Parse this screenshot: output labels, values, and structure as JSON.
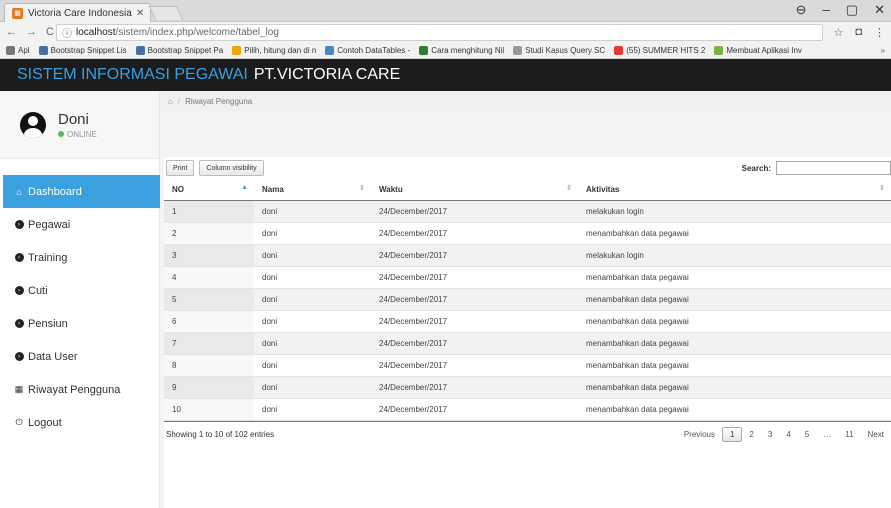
{
  "browser": {
    "tab_title": "Victoria Care Indonesia",
    "url_host": "localhost",
    "url_path": "/sistem/index.php/welcome/tabel_log",
    "bookmarks": [
      {
        "label": "Apl",
        "color": "#777"
      },
      {
        "label": "Bootstrap Snippet Lis",
        "color": "#4a6fa5"
      },
      {
        "label": "Bootstrap Snippet Pa",
        "color": "#4a6fa5"
      },
      {
        "label": "Pilih, hitung dan di n",
        "color": "#f0a500"
      },
      {
        "label": "Contoh DataTables -",
        "color": "#4a86c5"
      },
      {
        "label": "Cara menghitung Nil",
        "color": "#2e7d32"
      },
      {
        "label": "Studi Kasus Query SC",
        "color": "#999"
      },
      {
        "label": "(55) SUMMER HITS 2",
        "color": "#e53935"
      },
      {
        "label": "Membuat Aplikasi Inv",
        "color": "#7cb342"
      }
    ],
    "more": "»"
  },
  "app": {
    "title_blue": "SISTEM INFORMASI PEGAWAI",
    "title_white": "PT.VICTORIA CARE"
  },
  "profile": {
    "name": "Doni",
    "status": "ONLINE"
  },
  "menu": [
    {
      "label": "Dashboard",
      "icon": "home-icon",
      "active": true
    },
    {
      "label": "Pegawai",
      "icon": "circle-arrow-icon",
      "active": false
    },
    {
      "label": "Training",
      "icon": "circle-arrow-icon",
      "active": false
    },
    {
      "label": "Cuti",
      "icon": "circle-arrow-icon",
      "active": false
    },
    {
      "label": "Pensiun",
      "icon": "circle-arrow-icon",
      "active": false
    },
    {
      "label": "Data User",
      "icon": "circle-arrow-icon",
      "active": false
    },
    {
      "label": "Riwayat Pengguna",
      "icon": "calendar-icon",
      "active": false
    },
    {
      "label": "Logout",
      "icon": "power-icon",
      "active": false
    }
  ],
  "breadcrumb": {
    "current": "Riwayat Pengguna"
  },
  "toolbar": {
    "print": "Print",
    "colvis": "Column visibility",
    "search_label": "Search:",
    "search_value": ""
  },
  "table": {
    "headers": [
      "NO",
      "Nama",
      "Waktu",
      "Aktivitas"
    ],
    "rows": [
      [
        "1",
        "doni",
        "24/December/2017",
        "melakukan login"
      ],
      [
        "2",
        "doni",
        "24/December/2017",
        "menambahkan data pegawai"
      ],
      [
        "3",
        "doni",
        "24/December/2017",
        "melakukan login"
      ],
      [
        "4",
        "doni",
        "24/December/2017",
        "menambahkan data pegawai"
      ],
      [
        "5",
        "doni",
        "24/December/2017",
        "menambahkan data pegawai"
      ],
      [
        "6",
        "doni",
        "24/December/2017",
        "menambahkan data pegawai"
      ],
      [
        "7",
        "doni",
        "24/December/2017",
        "menambahkan data pegawai"
      ],
      [
        "8",
        "doni",
        "24/December/2017",
        "menambahkan data pegawai"
      ],
      [
        "9",
        "doni",
        "24/December/2017",
        "menambahkan data pegawai"
      ],
      [
        "10",
        "doni",
        "24/December/2017",
        "menambahkan data pegawai"
      ]
    ]
  },
  "footer": {
    "info": "Showing 1 to 10 of 102 entries",
    "previous": "Previous",
    "pages": [
      "1",
      "2",
      "3",
      "4",
      "5",
      "…",
      "11"
    ],
    "current_page": "1",
    "next": "Next"
  }
}
